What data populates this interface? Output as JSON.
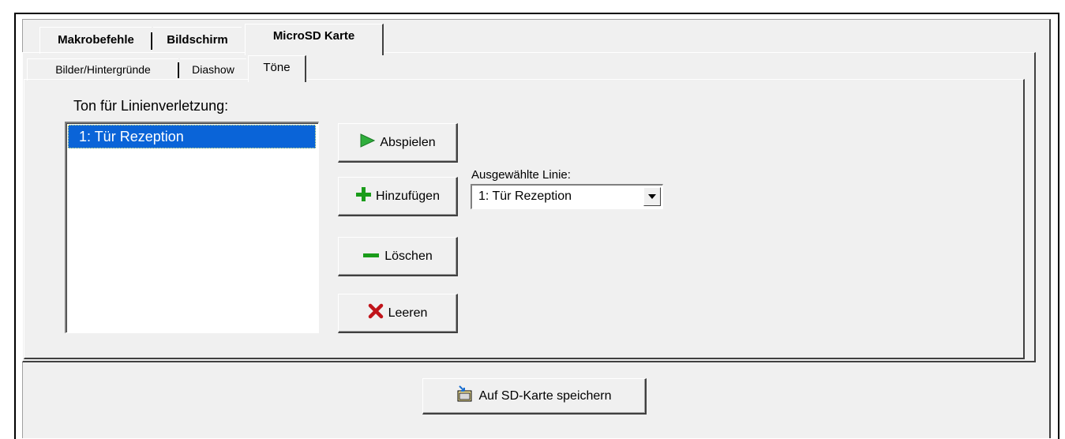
{
  "outer_tabs": [
    {
      "label": "Makrobefehle"
    },
    {
      "label": "Bildschirm"
    },
    {
      "label": "MicroSD Karte"
    }
  ],
  "inner_tabs": [
    {
      "label": "Bilder/Hintergründe"
    },
    {
      "label": "Diashow"
    },
    {
      "label": "Töne"
    }
  ],
  "tones": {
    "list_label": "Ton für Linienverletzung:",
    "list_items": [
      "1: Tür Rezeption"
    ],
    "buttons": {
      "play": "Abspielen",
      "add": "Hinzufügen",
      "delete": "Löschen",
      "clear": "Leeren"
    },
    "selected_line_label": "Ausgewählte Linie:",
    "selected_line_value": "1: Tür Rezeption"
  },
  "footer": {
    "save_label": "Auf SD-Karte speichern"
  },
  "icons": {
    "play": "play-icon",
    "add": "plus-icon",
    "delete": "minus-icon",
    "clear": "x-icon",
    "save": "sd-card-save-icon",
    "dropdown": "chevron-down-icon"
  },
  "colors": {
    "selection": "#0a64d8",
    "window": "#f0f0f0",
    "play_green": "#2fae3c",
    "plus_green": "#1a9c1a",
    "clear_red": "#c0141a"
  }
}
